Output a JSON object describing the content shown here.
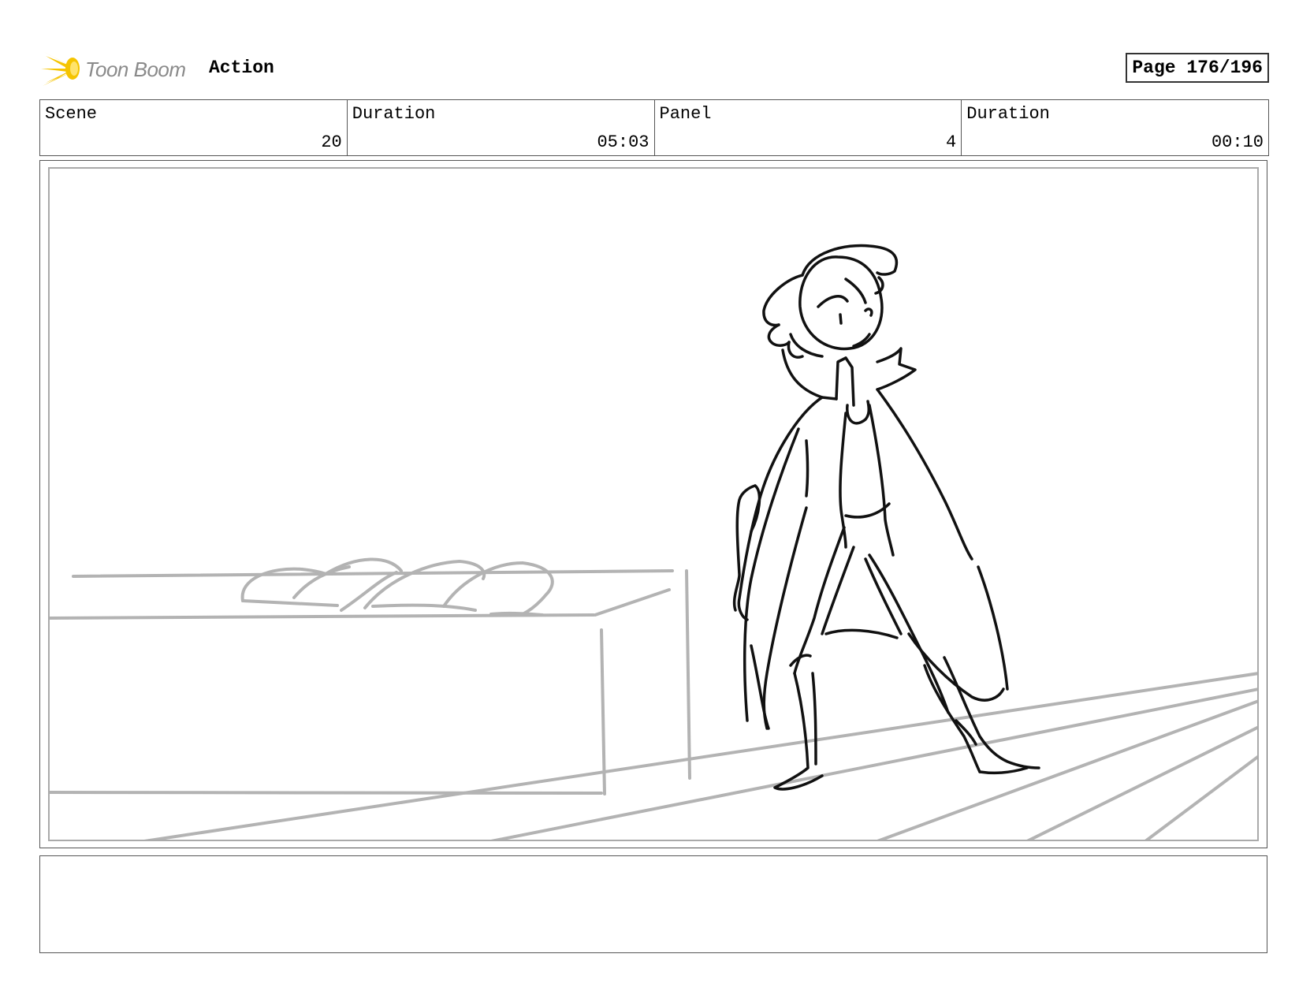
{
  "header": {
    "logo_text": "Toon Boom",
    "title": "Action",
    "page": "Page 176/196"
  },
  "info": {
    "scene_label": "Scene",
    "scene_value": "20",
    "scene_duration_label": "Duration",
    "scene_duration_value": "05:03",
    "panel_label": "Panel",
    "panel_value": "4",
    "panel_duration_label": "Duration",
    "panel_duration_value": "00:10"
  },
  "panel": {
    "sketch_line_color": "#111111",
    "background_line_color": "#b3b3b3"
  },
  "notes": {
    "text": ""
  }
}
